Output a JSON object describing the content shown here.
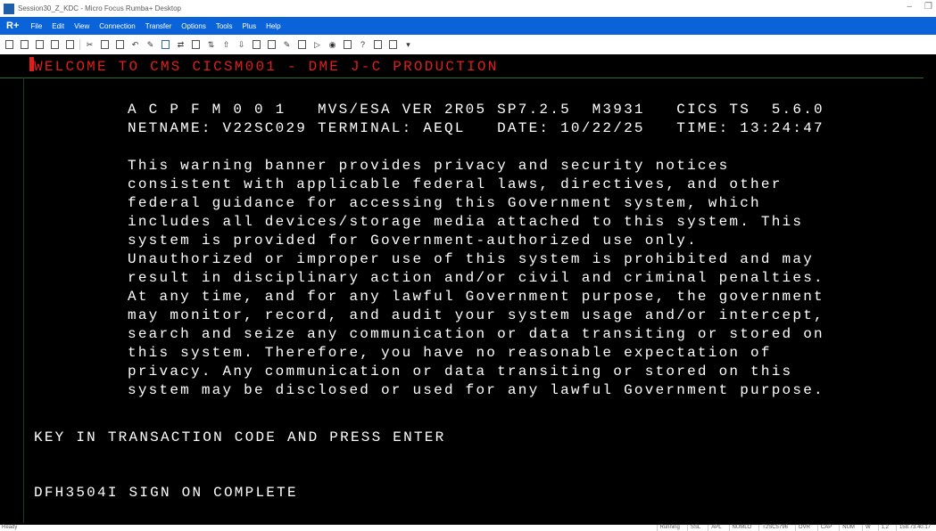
{
  "window": {
    "title": "Session30_Z_KDC - Micro Focus Rumba+ Desktop",
    "minimize": "–",
    "restore": "❐"
  },
  "menubar": {
    "logo": "R+",
    "items": [
      "File",
      "Edit",
      "View",
      "Connection",
      "Transfer",
      "Options",
      "Tools",
      "Plus",
      "Help"
    ]
  },
  "toolbar": {
    "icons": [
      "new-session-icon",
      "open-icon",
      "save-icon",
      "save-as-icon",
      "print-icon",
      "cut-icon",
      "copy-icon",
      "paste-icon",
      "undo-icon",
      "macro-icon",
      "connect-icon",
      "disconnect-icon",
      "send-icon",
      "receive-icon",
      "upload-icon",
      "download-icon",
      "print-screen-icon",
      "keyboard-map-icon",
      "edit-icon",
      "record-icon",
      "play-icon",
      "stop-icon",
      "help-icon",
      "question-icon",
      "about-icon",
      "settings-icon",
      "dropdown-icon"
    ]
  },
  "terminal": {
    "colors": {
      "background": "#000000",
      "text": "#ffffff",
      "highlight": "#e01e1e"
    },
    "lines": {
      "welcome": "WELCOME TO CMS CICSM001 - DME J-C PRODUCTION",
      "system_info": "A C P F M 0 0 1   MVS/ESA VER 2R05 SP7.2.5  M3931   CICS TS  5.6.0",
      "netname": "NETNAME: V22SC029 TERMINAL: AEQL   DATE: 10/22/25   TIME: 13:24:47",
      "banner": [
        "This warning banner provides privacy and security notices",
        "consistent with applicable federal laws, directives, and other",
        "federal guidance for accessing this Government system, which",
        "includes all devices/storage media attached to this system. This",
        "system is provided for Government-authorized use only.",
        "Unauthorized or improper use of this system is prohibited and may",
        "result in disciplinary action and/or civil and criminal penalties.",
        "At any time, and for any lawful Government purpose, the government",
        "may monitor, record, and audit your system usage and/or intercept,",
        "search and seize any communication or data transiting or stored on",
        "this system. Therefore, you have no reasonable expectation of",
        "privacy. Any communication or data transiting or stored on this",
        "system may be disclosed or used for any lawful Government purpose."
      ],
      "prompt": "KEY IN TRANSACTION CODE AND PRESS ENTER",
      "status_message": "DFH3504I SIGN ON COMPLETE"
    }
  },
  "statusbar": {
    "left": "Ready",
    "right": [
      "Running",
      "SSL",
      "APL",
      "NUMLO",
      "T2SC5796",
      "OVR",
      "CAP",
      "NUM",
      "W",
      "1,2",
      "158.73.40.17"
    ]
  }
}
